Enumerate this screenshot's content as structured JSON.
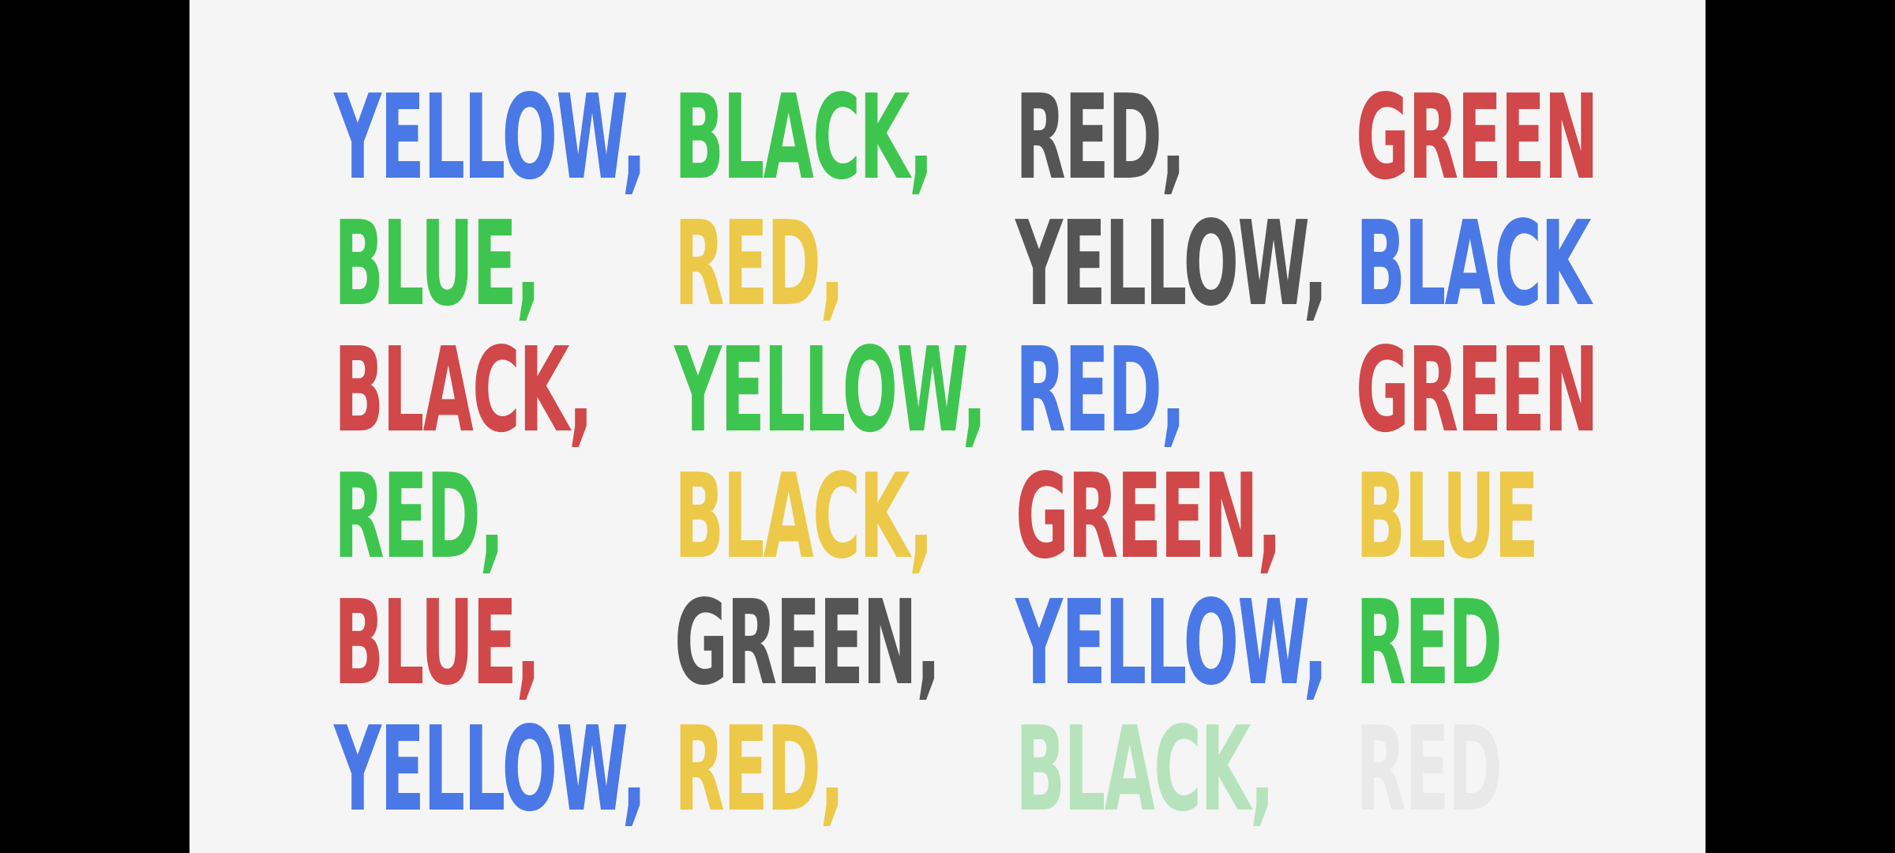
{
  "colors": {
    "blue": "#4a78e6",
    "green": "#3ec54f",
    "black": "#555555",
    "red": "#d0484a",
    "yellow": "#edc94a",
    "fadedGreen": "#b6e3bc",
    "fadedGray": "#e9e9e9"
  },
  "rows": [
    [
      {
        "text": "YELLOW,",
        "color": "#4a78e6"
      },
      {
        "text": "BLACK,",
        "color": "#3ec54f"
      },
      {
        "text": "RED,",
        "color": "#555555"
      },
      {
        "text": "GREEN",
        "color": "#d0484a"
      }
    ],
    [
      {
        "text": "BLUE,",
        "color": "#3ec54f"
      },
      {
        "text": "RED,",
        "color": "#edc94a"
      },
      {
        "text": "YELLOW,",
        "color": "#555555"
      },
      {
        "text": "BLACK",
        "color": "#4a78e6"
      }
    ],
    [
      {
        "text": "BLACK,",
        "color": "#d0484a"
      },
      {
        "text": "YELLOW,",
        "color": "#3ec54f"
      },
      {
        "text": "RED,",
        "color": "#4a78e6"
      },
      {
        "text": "GREEN",
        "color": "#d0484a"
      }
    ],
    [
      {
        "text": "RED,",
        "color": "#3ec54f"
      },
      {
        "text": "BLACK,",
        "color": "#edc94a"
      },
      {
        "text": "GREEN,",
        "color": "#d0484a"
      },
      {
        "text": "BLUE",
        "color": "#edc94a"
      }
    ],
    [
      {
        "text": "BLUE,",
        "color": "#d0484a"
      },
      {
        "text": "GREEN,",
        "color": "#555555"
      },
      {
        "text": "YELLOW,",
        "color": "#4a78e6"
      },
      {
        "text": "RED",
        "color": "#3ec54f"
      }
    ],
    [
      {
        "text": "YELLOW,",
        "color": "#4a78e6"
      },
      {
        "text": "RED,",
        "color": "#edc94a"
      },
      {
        "text": "BLACK,",
        "color": "#b6e3bc"
      },
      {
        "text": "RED",
        "color": "#e9e9e9"
      }
    ]
  ]
}
